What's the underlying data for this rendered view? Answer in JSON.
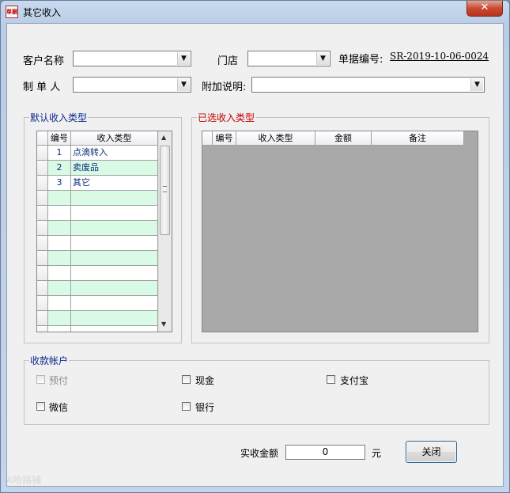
{
  "window": {
    "title": "其它收入",
    "app_icon_text": "单据",
    "close_glyph": "✕"
  },
  "form": {
    "customer_label": "客户名称",
    "customer_value": "",
    "store_label": "门店",
    "store_value": "",
    "docno_label": "单据编号:",
    "docno_value": "SR-2019-10-06-0024",
    "maker_label": "制 单 人",
    "maker_value": "",
    "note_label": "附加说明:",
    "note_value": ""
  },
  "default_types": {
    "legend": "默认收入类型",
    "columns": [
      "编号",
      "收入类型"
    ],
    "rows": [
      {
        "no": "1",
        "type": "点滴转入"
      },
      {
        "no": "2",
        "type": "卖废品"
      },
      {
        "no": "3",
        "type": "其它"
      },
      {
        "no": "",
        "type": ""
      },
      {
        "no": "",
        "type": ""
      },
      {
        "no": "",
        "type": ""
      },
      {
        "no": "",
        "type": ""
      },
      {
        "no": "",
        "type": ""
      },
      {
        "no": "",
        "type": ""
      },
      {
        "no": "",
        "type": ""
      },
      {
        "no": "",
        "type": ""
      },
      {
        "no": "",
        "type": ""
      },
      {
        "no": "",
        "type": ""
      }
    ]
  },
  "selected_types": {
    "legend": "已选收入类型",
    "columns": [
      "编号",
      "收入类型",
      "金额",
      "备注"
    ]
  },
  "account": {
    "legend": "收款帐户",
    "options": [
      {
        "label": "预付",
        "checked": false,
        "disabled": true
      },
      {
        "label": "现金",
        "checked": false,
        "disabled": false
      },
      {
        "label": "支付宝",
        "checked": false,
        "disabled": false
      },
      {
        "label": "微信",
        "checked": false,
        "disabled": false
      },
      {
        "label": "银行",
        "checked": false,
        "disabled": false
      }
    ]
  },
  "footer": {
    "amount_label": "实收金额",
    "amount_value": "0",
    "unit": "元",
    "close_button": "关闭"
  },
  "watermark": "A哈路铺",
  "colors": {
    "row_alt": "#d9fbe6",
    "selected_grid_bg": "#a9a9a9",
    "legend_default": "#0b2a8c",
    "legend_selected": "#c00000",
    "grid_text": "#0a2d7a"
  }
}
